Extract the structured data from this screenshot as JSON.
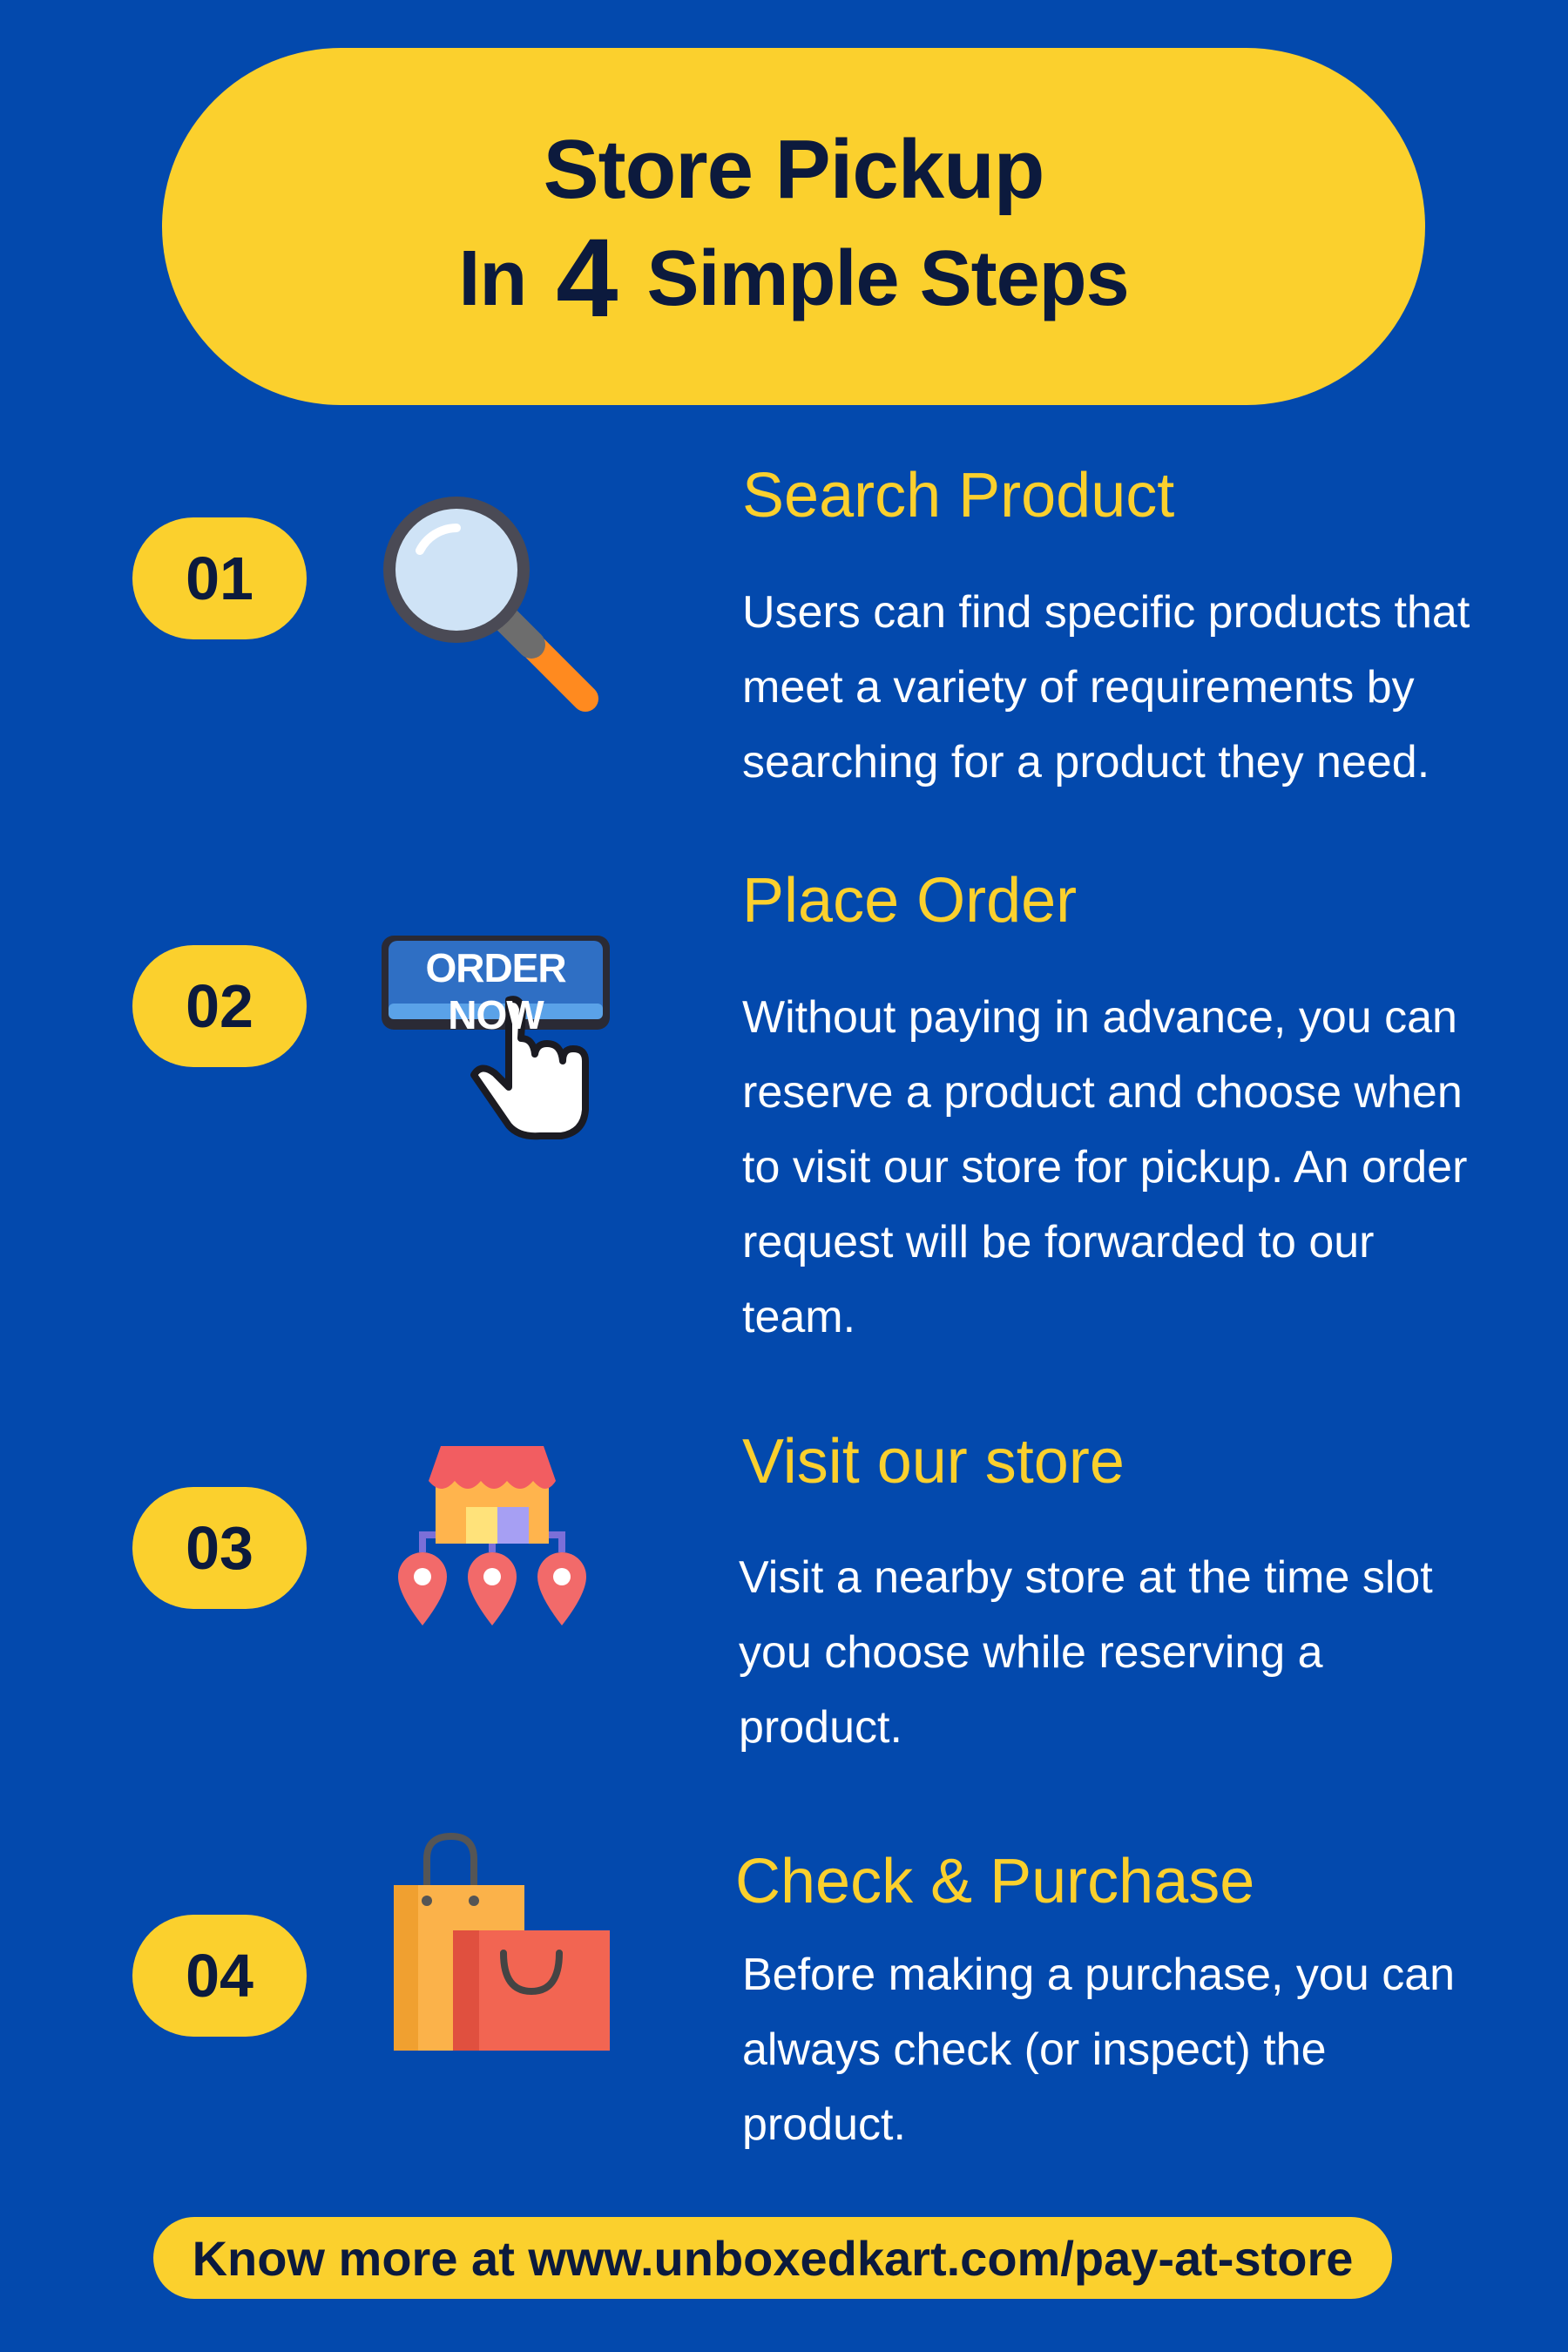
{
  "header": {
    "line1": "Store Pickup",
    "line2_prefix": "In",
    "line2_number": "4",
    "line2_suffix": "Simple Steps"
  },
  "steps": [
    {
      "number": "01",
      "title": "Search Product",
      "icon": "magnifying-glass-icon",
      "desc_lines": [
        "Users can find specific products that",
        "meet a variety of requirements by",
        "searching for a product they need."
      ]
    },
    {
      "number": "02",
      "title": "Place Order",
      "icon": "order-now-button-icon",
      "icon_label": "ORDER NOW",
      "desc_lines": [
        "Without paying in advance, you can",
        "reserve a product and choose when",
        "to visit our store for pickup. An order",
        "request will be forwarded to our",
        "team."
      ]
    },
    {
      "number": "03",
      "title": "Visit our store",
      "icon": "store-locations-icon",
      "desc_lines": [
        "Visit a nearby store at the time slot",
        "you choose while reserving a",
        "product."
      ]
    },
    {
      "number": "04",
      "title": "Check & Purchase",
      "icon": "shopping-bags-icon",
      "desc_lines": [
        "Before making a purchase, you can",
        "always check (or inspect) the",
        "product."
      ]
    }
  ],
  "footer": {
    "text": "Know more at www.unboxedkart.com/pay-at-store"
  },
  "colors": {
    "background": "#0349ad",
    "accent": "#fbd02d",
    "dark_text": "#0c1a3d",
    "body_text": "#ffffff"
  }
}
